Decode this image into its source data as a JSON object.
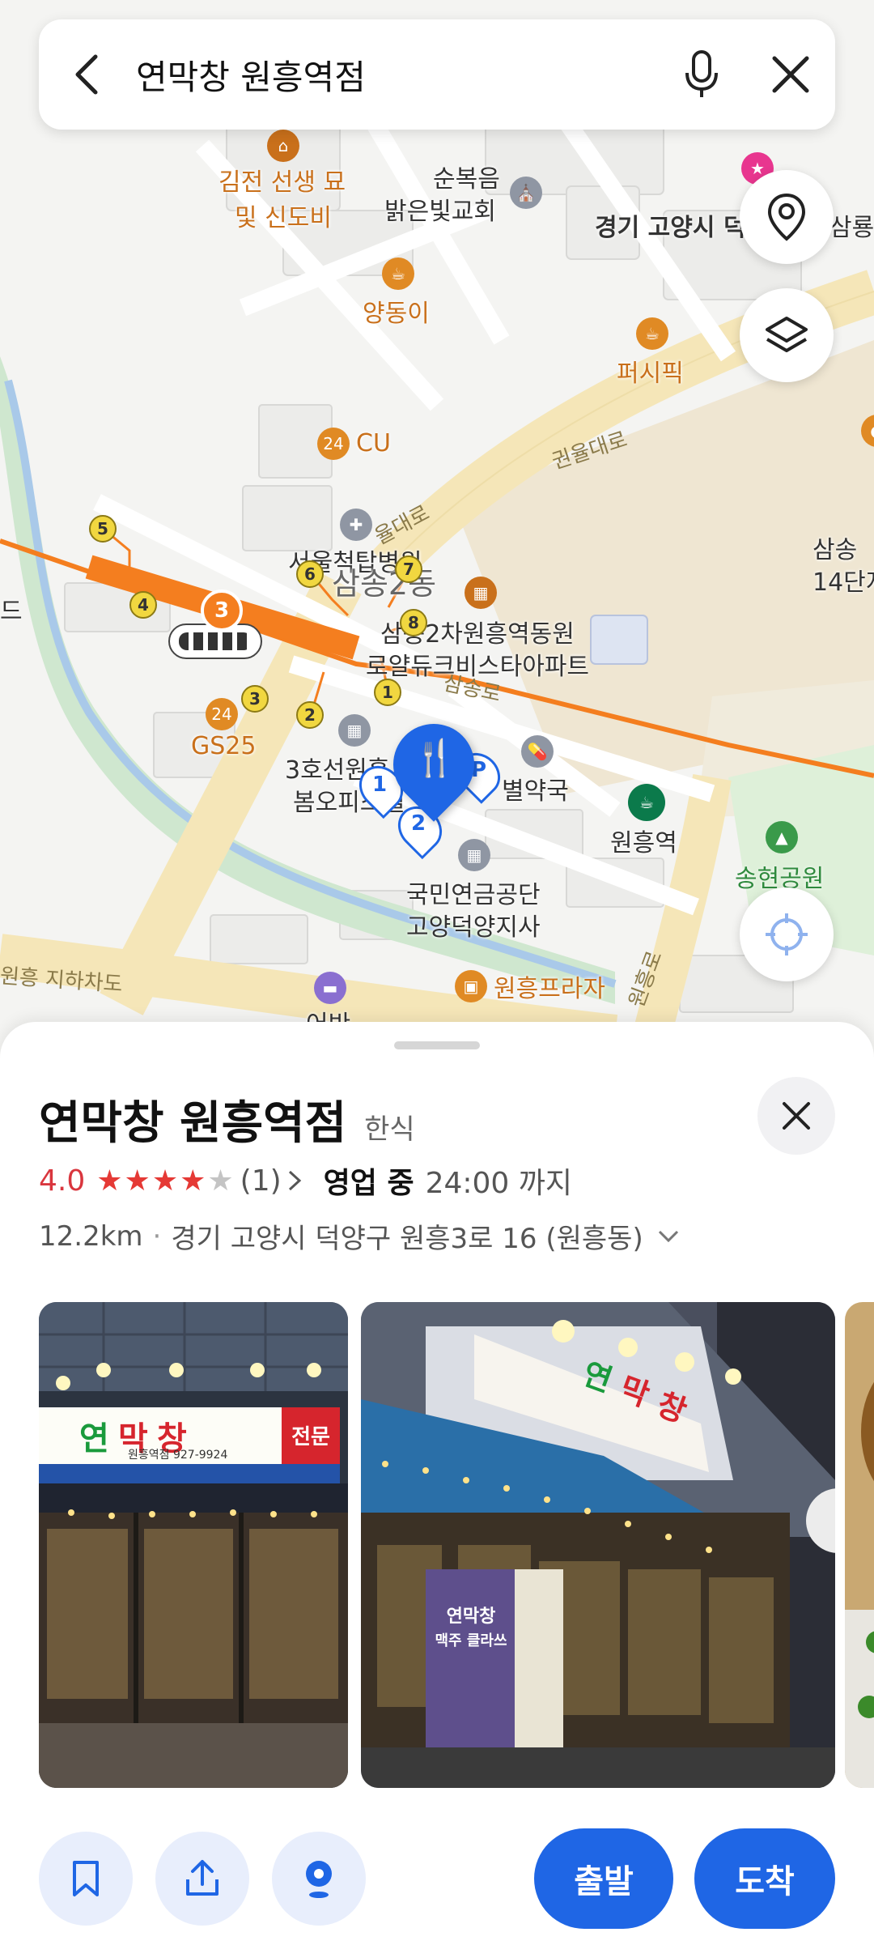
{
  "search": {
    "query": "연막창 원흥역점"
  },
  "map": {
    "road_labels": [
      "권율대로",
      "율대로",
      "삼송로",
      "원흥 지하차도",
      "원흥로"
    ],
    "poi_labels": {
      "grave": [
        "김전 선생 묘",
        "및 신도비"
      ],
      "church": [
        "순복음",
        "밝은빛교회"
      ],
      "goyang": "경기 고양시 덕",
      "cafe_yang": "양동이",
      "cafe_pacific": "퍼시픽",
      "cu": "CU",
      "seoul_hospital": "서울척탑병원",
      "samsong2": "삼송2동",
      "apt": [
        "삼송2차원흥역동원",
        "로얄듀크비스타아파트"
      ],
      "gs25": "GS25",
      "line3": [
        "3호선원흥",
        "봄오피스텔"
      ],
      "pharmacy": "별약국",
      "wonheung_station": "원흥역",
      "songhyeon_park": "송현공원",
      "nps": [
        "국민연금공단",
        "고양덕양지사"
      ],
      "wonheung_plaza": "원흥프라자",
      "samsong_right": [
        "삼송",
        "14단지"
      ],
      "left_edge": "드",
      "motel": "어반",
      "edge_top_right": "삼룡집"
    },
    "exit_numbers": [
      "5",
      "6",
      "7",
      "4",
      "8",
      "3",
      "2",
      "1"
    ],
    "parking_markers": [
      "1",
      "2"
    ],
    "accent_color": "#1f66e5",
    "subway_color": "#f47e1f"
  },
  "place": {
    "name": "연막창 원흥역점",
    "category": "한식",
    "rating": "4.0",
    "stars": 4,
    "review_count": "(1)",
    "status": "영업 중",
    "hours": "24:00 까지",
    "distance": "12.2km",
    "address": "경기 고양시 덕양구 원흥3로 16 (원흥동)"
  },
  "photos": {
    "sign1": [
      "연",
      "막",
      "창",
      "전문"
    ],
    "sign_sub": "원흥역점 927-9924",
    "poster": [
      "연막창",
      "맥주 클라쓰"
    ]
  },
  "actions": {
    "depart": "출발",
    "arrive": "도착"
  }
}
